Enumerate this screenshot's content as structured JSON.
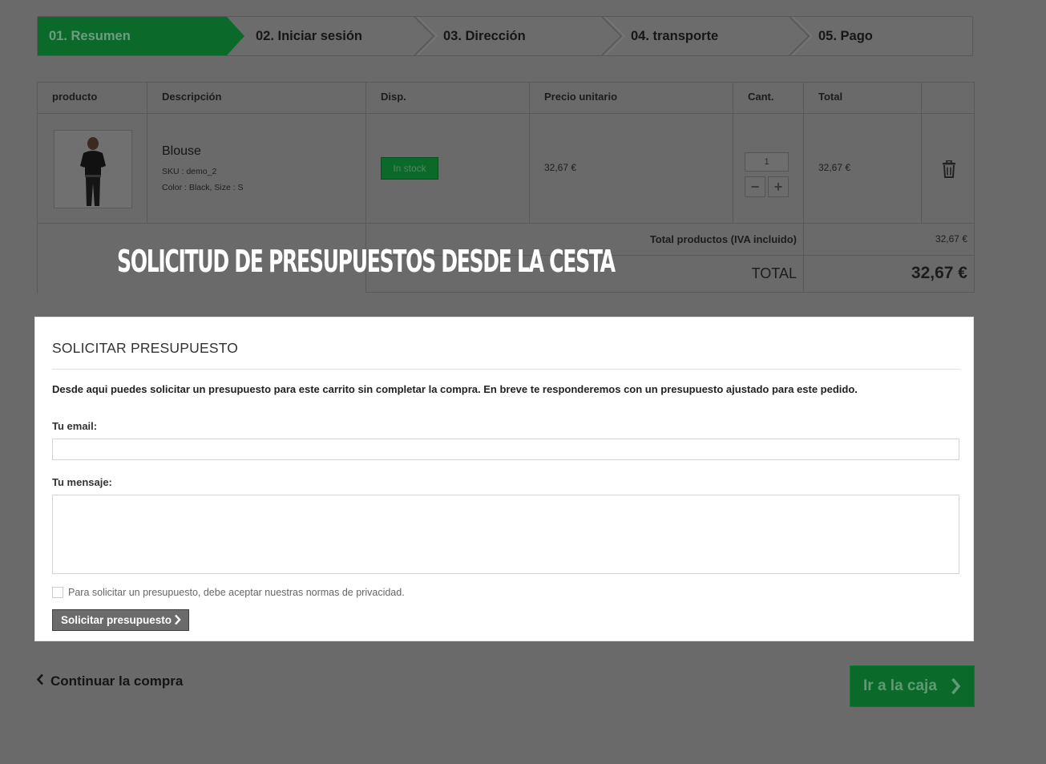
{
  "steps": [
    {
      "label": "01. Resumen"
    },
    {
      "label": "02. Iniciar sesión"
    },
    {
      "label": "03. Dirección"
    },
    {
      "label": "04. transporte"
    },
    {
      "label": "05. Pago"
    }
  ],
  "cart": {
    "headers": {
      "product": "producto",
      "description": "Descripción",
      "availability": "Disp.",
      "unit_price": "Precio unitario",
      "qty": "Cant.",
      "total": "Total"
    },
    "item": {
      "name": "Blouse",
      "sku": "SKU : demo_2",
      "attributes": "Color : Black, Size : S",
      "availability": "In stock",
      "unit_price": "32,67 €",
      "quantity": "1",
      "total": "32,67 €"
    },
    "summary": {
      "products_label": "Total productos (IVA incluido)",
      "products_value": "32,67 €",
      "total_label": "TOTAL",
      "total_value": "32,67 €"
    }
  },
  "overlay_title": "Solicitud de presupuestos desde la cesta",
  "quote": {
    "title": "SOLICITAR PRESUPUESTO",
    "description": "Desde aqui puedes solicitar un presupuesto para este carrito sin completar la compra. En breve te responderemos con un presupuesto ajustado para este pedido.",
    "email_label": "Tu email:",
    "email_value": "",
    "message_label": "Tu mensaje:",
    "message_value": "",
    "privacy_label": "Para solicitar un presupuesto, debe aceptar nuestras normas de privacidad.",
    "submit_label": "Solicitar presupuesto"
  },
  "nav": {
    "continue_label": "Continuar la compra",
    "checkout_label": "Ir a la caja"
  },
  "colors": {
    "brand_green": "#0b6a2a",
    "overlay": "#6a6a6a",
    "panel_bg": "#ffffff"
  },
  "icons": [
    "trash-icon",
    "chevron-left-icon",
    "chevron-right-icon",
    "minus-icon",
    "plus-icon"
  ]
}
